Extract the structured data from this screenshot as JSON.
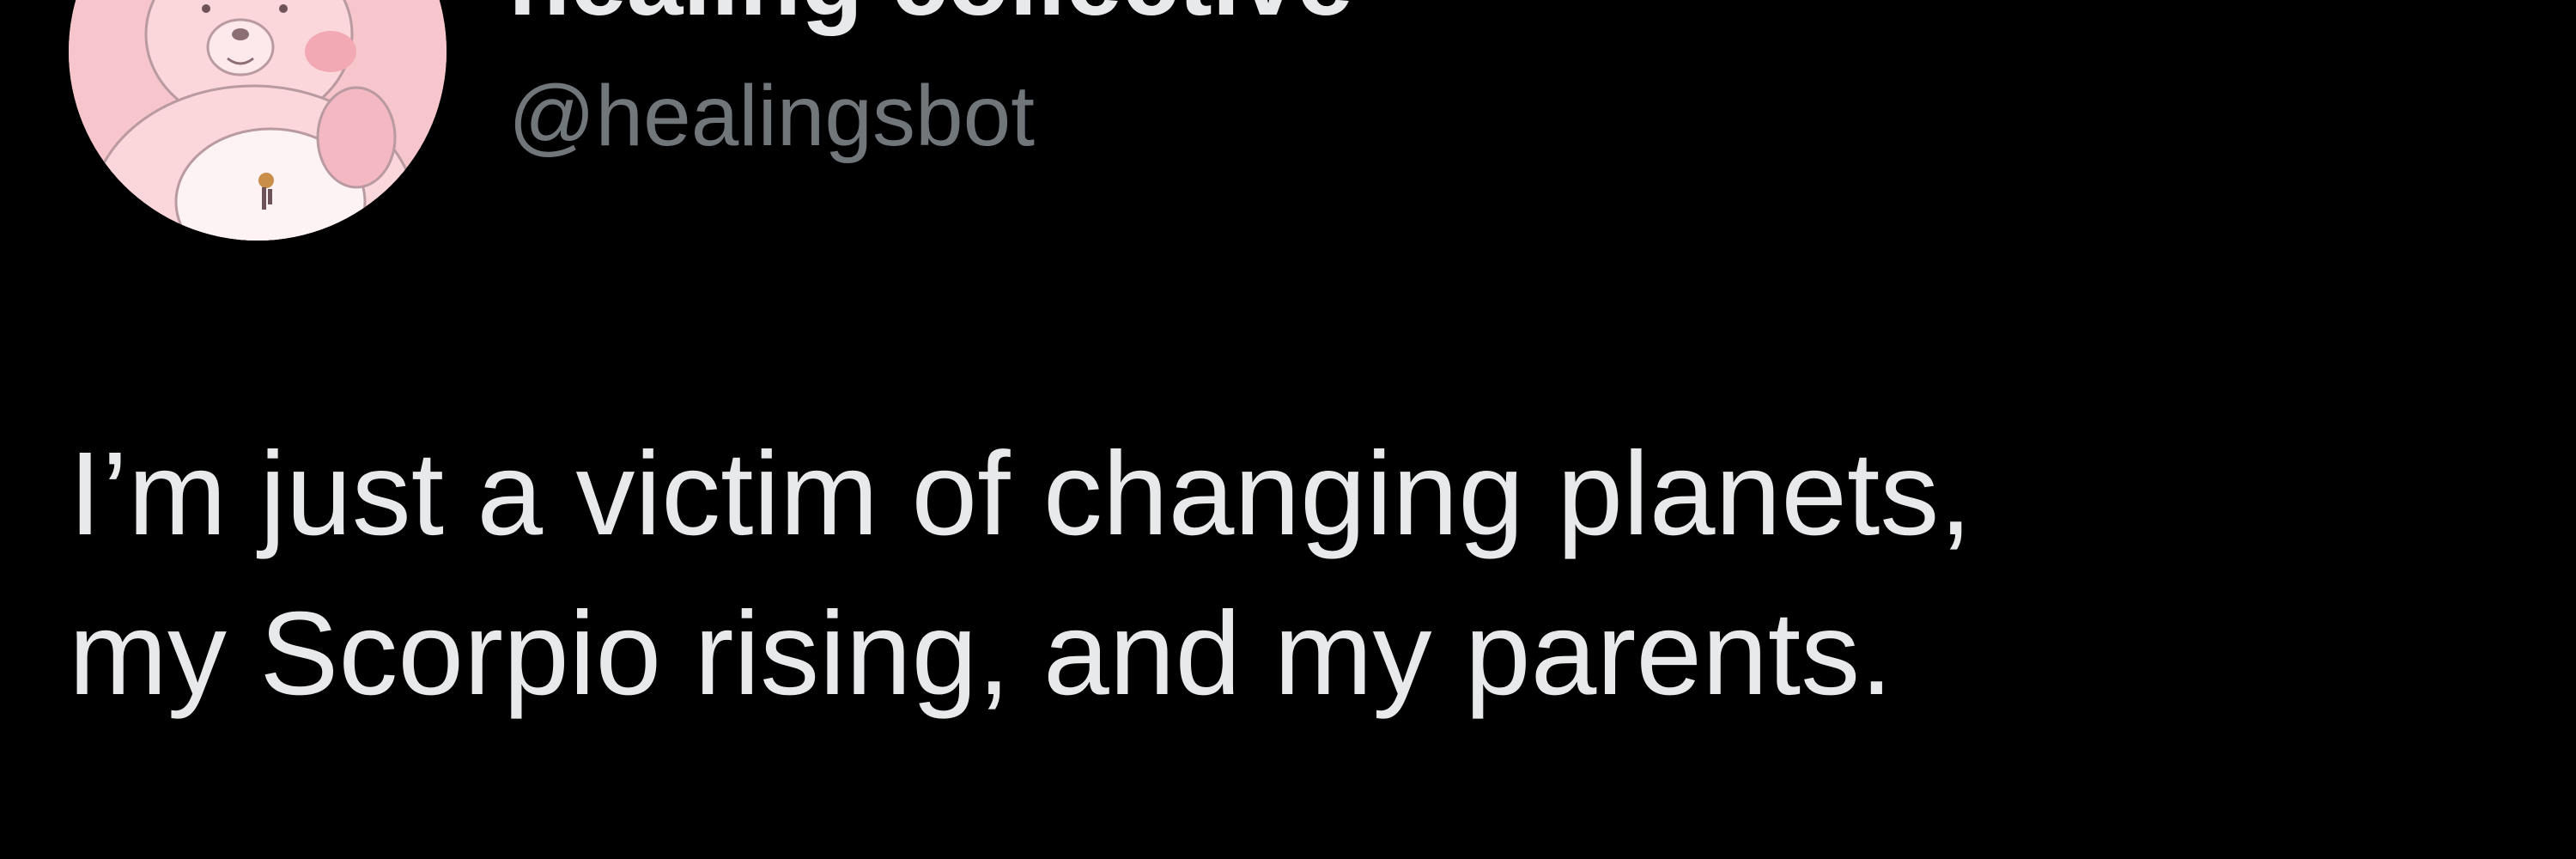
{
  "tweet": {
    "author": {
      "display_name": "healing collective",
      "handle": "@healingsbot",
      "avatar_icon": "pink-care-bear-avatar"
    },
    "text_lines": [
      "I’m just a victim of changing planets,",
      "my Scorpio rising, and my parents."
    ]
  },
  "colors": {
    "background": "#000000",
    "primary_text": "#e7e9ea",
    "secondary_text": "#71767b",
    "avatar_bg": "#f7c6cd"
  }
}
